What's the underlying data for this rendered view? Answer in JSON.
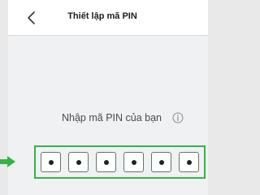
{
  "header": {
    "title": "Thiết lập mã PIN",
    "back_icon": "chevron-left-icon"
  },
  "pin_entry": {
    "prompt": "Nhập mã PIN của bạn",
    "info_icon": "info-circle-icon",
    "digit_count": 6,
    "filled_count": 6,
    "digits": [
      "•",
      "•",
      "•",
      "•",
      "•",
      "•"
    ]
  },
  "annotation": {
    "arrow_icon": "arrow-right-icon",
    "highlight_color": "#36b24a"
  }
}
